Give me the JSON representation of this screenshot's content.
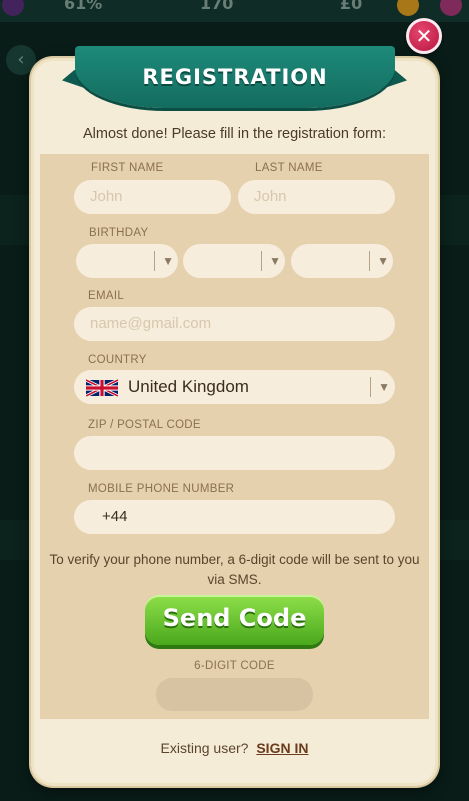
{
  "background": {
    "stats": [
      "61%",
      "170",
      "£0"
    ]
  },
  "modal": {
    "title": "REGISTRATION",
    "intro": "Almost done! Please fill in the registration form:",
    "first_name": {
      "label": "FIRST NAME",
      "placeholder": "John"
    },
    "last_name": {
      "label": "LAST NAME",
      "placeholder": "John"
    },
    "birthday": {
      "label": "BIRTHDAY"
    },
    "email": {
      "label": "EMAIL",
      "placeholder": "name@gmail.com"
    },
    "country": {
      "label": "COUNTRY",
      "value": "United Kingdom"
    },
    "zip": {
      "label": "ZIP / POSTAL CODE",
      "value": ""
    },
    "phone": {
      "label": "MOBILE PHONE NUMBER",
      "value": "+44"
    },
    "sms_note": "To verify your phone number, a 6-digit code will be sent to you via SMS.",
    "send_code_label": "Send Code",
    "code": {
      "label": "6-DIGIT CODE"
    },
    "footer_text": "Existing user?",
    "sign_in_label": "SIGN IN"
  },
  "colors": {
    "ribbon": "#136c5f",
    "accent_button": "#4aa81c",
    "close_button": "#b5163f"
  }
}
